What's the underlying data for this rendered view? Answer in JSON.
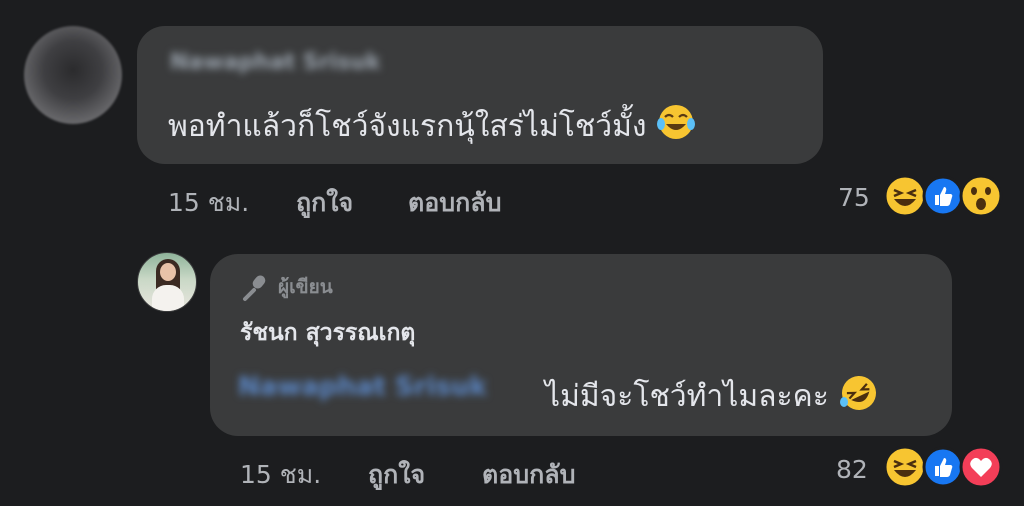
{
  "comment1": {
    "author_name": "Nawaphat Srisuk",
    "text": "พอทำแล้วก็โชว์จังแรกนุ้ใสร่ไม่โชว์มั้ง",
    "time": "15 ชม.",
    "like_label": "ถูกใจ",
    "reply_label": "ตอบกลับ",
    "reaction_count": "75",
    "reactions": [
      "laugh-reaction-icon",
      "like-reaction-icon",
      "wow-reaction-icon"
    ]
  },
  "reply1": {
    "author_badge": "ผู้เขียน",
    "author_name": "รัชนก สุวรรณเกตุ",
    "mention": "Nawaphat Srisuk",
    "text": "ไม่มีจะโชว์ทำไมละคะ",
    "time": "15 ชม.",
    "like_label": "ถูกใจ",
    "reply_label": "ตอบกลับ",
    "reaction_count": "82",
    "reactions": [
      "laugh-reaction-icon",
      "like-reaction-icon",
      "love-reaction-icon"
    ]
  },
  "colors": {
    "background": "#1c1d1f",
    "bubble": "#3a3b3c",
    "like_blue": "#1877f2",
    "love_red": "#f33e58",
    "emoji_yellow": "#f7c531"
  }
}
